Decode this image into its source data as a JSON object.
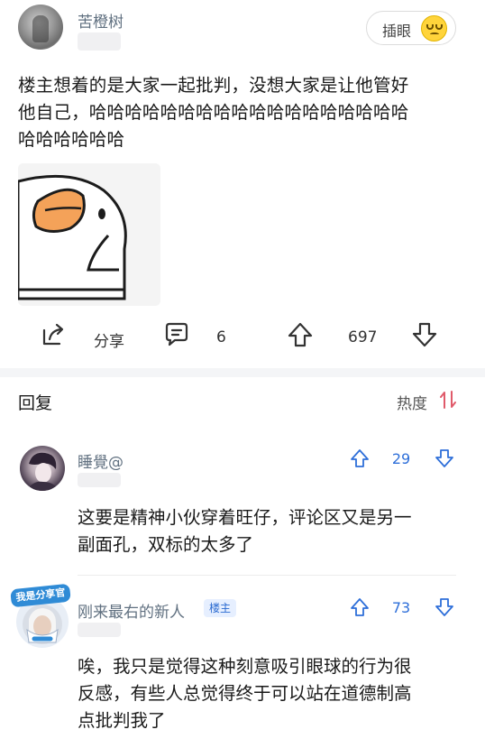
{
  "post": {
    "author_name": "苦橙树",
    "plug_button_label": "插眼",
    "body_line1": "楼主想着的是大家一起批判，没想大家是让他管好",
    "body_line2": "他自己，哈哈哈哈哈哈哈哈哈哈哈哈哈哈哈哈哈哈",
    "body_line3": "哈哈哈哈哈哈",
    "share_label": "分享",
    "comment_count": "6",
    "vote_count": "697"
  },
  "replies": {
    "title": "回复",
    "sort_label": "热度"
  },
  "comments": [
    {
      "name": "睡覺@",
      "votes": "29",
      "text_line1": "这要是精神小伙穿着旺仔，评论区又是另一",
      "text_line2": "副面孔，双标的太多了"
    },
    {
      "name": "刚来最右的新人",
      "badge": "楼主",
      "avatar_caption": "我是分享官",
      "votes": "73",
      "text_line1": "唉，我只是觉得这种刻意吸引眼球的行为很",
      "text_line2": "反感，有些人总觉得终于可以站在道德制高",
      "text_line3": "点批判我了"
    }
  ],
  "colors": {
    "accent_blue": "#2e6fd9",
    "sort_red": "#e05a6a",
    "name_gray": "#607080"
  },
  "icons": {
    "share": "share-icon",
    "comment": "comment-icon",
    "upvote": "upvote-arrow-icon",
    "downvote": "downvote-arrow-icon",
    "sort": "sort-arrows-icon",
    "emoji": "smiling-emoji-icon"
  }
}
